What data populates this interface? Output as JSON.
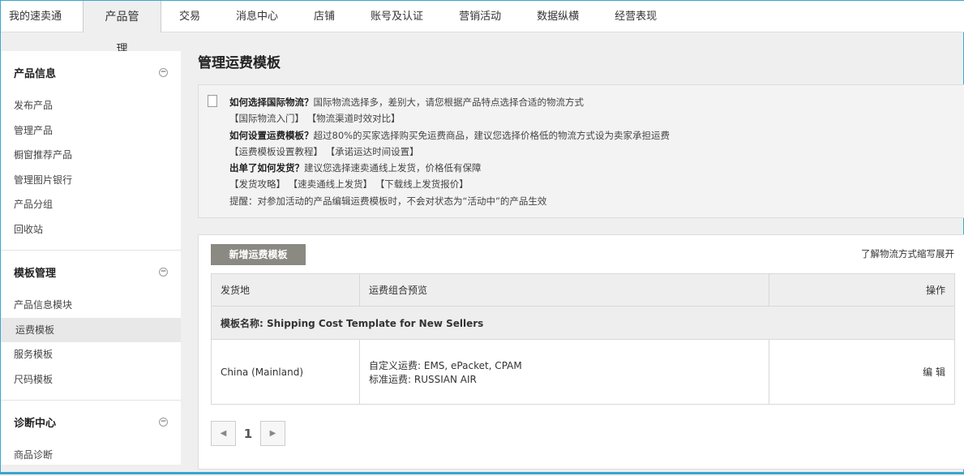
{
  "nav": [
    "我的速卖通",
    "产品管理",
    "交易",
    "消息中心",
    "店铺",
    "账号及认证",
    "营销活动",
    "数据纵横",
    "经营表现"
  ],
  "sidebar": [
    {
      "title": "产品信息",
      "items": [
        "发布产品",
        "管理产品",
        "橱窗推荐产品",
        "管理图片银行",
        "产品分组",
        "回收站"
      ]
    },
    {
      "title": "模板管理",
      "items": [
        "产品信息模块",
        "运费模板",
        "服务模板",
        "尺码模板"
      ]
    },
    {
      "title": "诊断中心",
      "items": [
        "商品诊断"
      ]
    }
  ],
  "page_title": "管理运费模板",
  "info": {
    "q1": "如何选择国际物流？",
    "a1": "国际物流选择多，差别大，请您根据产品特点选择合适的物流方式",
    "l1": [
      "【国际物流入门】",
      "【物流渠道时效对比】"
    ],
    "q2": "如何设置运费模板？",
    "a2": "超过80%的买家选择购买免运费商品，建议您选择价格低的物流方式设为卖家承担运费",
    "l2": [
      "【运费模板设置教程】",
      "【承诺运达时间设置】"
    ],
    "q3": "出单了如何发货？",
    "a3": "建议您选择速卖通线上发货，价格低有保障",
    "l3": [
      "【发货攻略】",
      "【速卖通线上发货】",
      "【下载线上发货报价】"
    ],
    "note": "提醒：对参加活动的产品编辑运费模板时，不会对状态为“活动中”的产品生效"
  },
  "panel": {
    "add_button": "新增运费模板",
    "expand_link": "了解物流方式缩写展开",
    "headers": [
      "发货地",
      "运费组合预览",
      "操作"
    ],
    "template_label": "模板名称:",
    "template_name": "Shipping Cost Template for New Sellers",
    "origin": "China (Mainland)",
    "custom": "自定义运费: EMS, ePacket, CPAM",
    "standard": "标准运费: RUSSIAN AIR",
    "edit": "编 辑",
    "page": "1"
  }
}
